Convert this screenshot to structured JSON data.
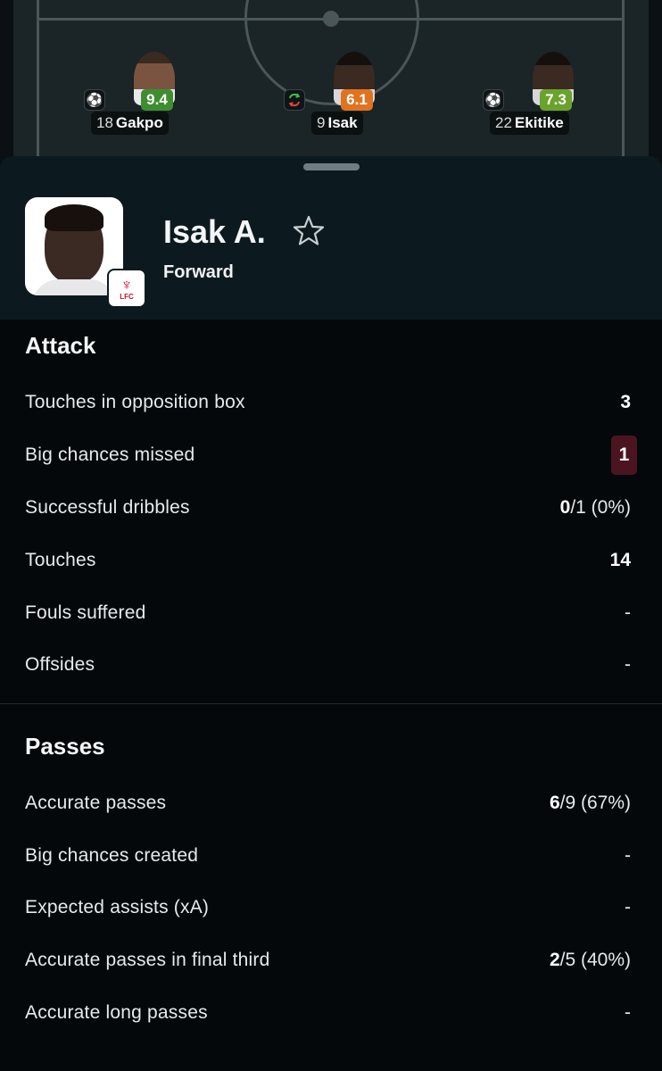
{
  "colors": {
    "rating_high": "#3e8e2f",
    "rating_mid": "#e0731f",
    "rating_good": "#6aa32b",
    "negative_badge": "#4a1521",
    "club": "#c8102e"
  },
  "lineup": [
    {
      "number": "18",
      "name": "Gakpo",
      "rating": "9.4",
      "icon": "football-icon",
      "rating_color": "#3e8e2f"
    },
    {
      "number": "9",
      "name": "Isak",
      "rating": "6.1",
      "icon": "substitution-icon",
      "rating_color": "#e0731f"
    },
    {
      "number": "22",
      "name": "Ekitike",
      "rating": "7.3",
      "icon": "football-icon",
      "rating_color": "#6aa32b"
    }
  ],
  "player": {
    "name": "Isak A.",
    "position": "Forward",
    "club_badge_text": "LFC"
  },
  "attack": {
    "title": "Attack",
    "rows": [
      {
        "label": "Touches in opposition box",
        "value_bold": "3",
        "value_rest": ""
      },
      {
        "label": "Big chances missed",
        "value_bold": "1",
        "value_rest": "",
        "highlight": true
      },
      {
        "label": "Successful dribbles",
        "value_bold": "0",
        "value_rest": "/1 (0%)"
      },
      {
        "label": "Touches",
        "value_bold": "14",
        "value_rest": ""
      },
      {
        "label": "Fouls suffered",
        "value_bold": "",
        "value_rest": "-"
      },
      {
        "label": "Offsides",
        "value_bold": "",
        "value_rest": "-"
      }
    ]
  },
  "passes": {
    "title": "Passes",
    "rows": [
      {
        "label": "Accurate passes",
        "value_bold": "6",
        "value_rest": "/9 (67%)"
      },
      {
        "label": "Big chances created",
        "value_bold": "",
        "value_rest": "-"
      },
      {
        "label": "Expected assists (xA)",
        "value_bold": "",
        "value_rest": "-"
      },
      {
        "label": "Accurate passes in final third",
        "value_bold": "2",
        "value_rest": "/5 (40%)"
      },
      {
        "label": "Accurate long passes",
        "value_bold": "",
        "value_rest": "-"
      }
    ]
  }
}
